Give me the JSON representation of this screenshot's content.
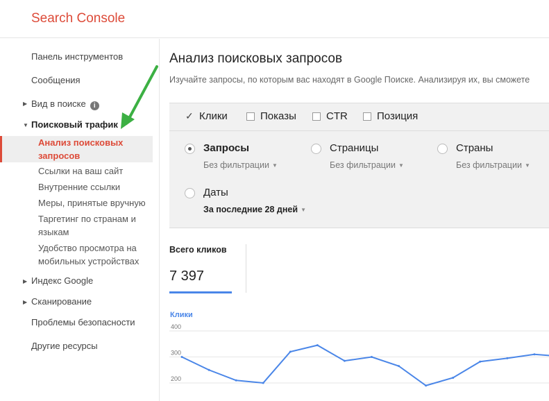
{
  "header": {
    "logo": "Search Console"
  },
  "sidebar": {
    "dashboard": "Панель инструментов",
    "messages": "Сообщения",
    "search_appearance": "Вид в поиске",
    "search_traffic": "Поисковый трафик",
    "traffic_items": [
      "Анализ поисковых запросов",
      "Ссылки на ваш сайт",
      "Внутренние ссылки",
      "Меры, принятые вручную",
      "Таргетинг по странам и языкам",
      "Удобство просмотра на мобильных устройствах"
    ],
    "google_index": "Индекс Google",
    "crawl": "Сканирование",
    "security": "Проблемы безопасности",
    "other": "Другие ресурсы"
  },
  "main": {
    "title": "Анализ поисковых запросов",
    "description": "Изучайте запросы, по которым вас находят в Google Поиске. Анализируя их, вы сможете"
  },
  "metrics": [
    {
      "label": "Клики",
      "checked": true
    },
    {
      "label": "Показы",
      "checked": false
    },
    {
      "label": "CTR",
      "checked": false
    },
    {
      "label": "Позиция",
      "checked": false
    }
  ],
  "groups": [
    {
      "label": "Запросы",
      "filter": "Без фильтрации",
      "selected": true
    },
    {
      "label": "Страницы",
      "filter": "Без фильтрации",
      "selected": false
    },
    {
      "label": "Страны",
      "filter": "Без фильтрации",
      "selected": false
    },
    {
      "label": "Даты",
      "filter": "За последние 28 дней",
      "selected": false
    }
  ],
  "summary": {
    "label": "Всего кликов",
    "value": "7 397"
  },
  "chart_data": {
    "type": "line",
    "title": "Клики",
    "ylim": [
      200,
      400
    ],
    "yticks": [
      "400",
      "300",
      "200"
    ],
    "series": [
      {
        "name": "Клики",
        "color": "#4a86e8",
        "values": [
          300,
          250,
          210,
          200,
          320,
          345,
          285,
          300,
          265,
          190,
          220,
          282,
          295,
          310,
          302
        ]
      }
    ]
  }
}
